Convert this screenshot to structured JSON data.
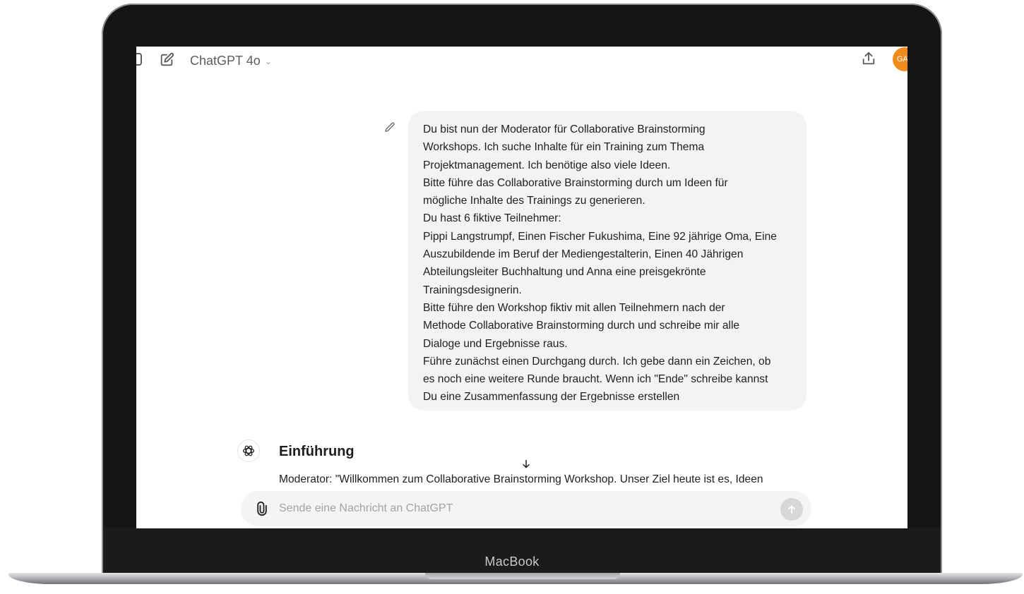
{
  "header": {
    "model_name": "ChatGPT 4o",
    "avatar_initials": "GA",
    "avatar_color": "#f08c1d"
  },
  "conversation": {
    "user_message_lines": [
      "Du bist nun der Moderator für Collaborative Brainstorming",
      "Workshops. Ich suche Inhalte für ein Training zum Thema",
      "Projektmanagement. Ich benötige also viele Ideen.",
      "Bitte führe das Collaborative Brainstorming durch um Ideen für",
      "mögliche Inhalte des Trainings zu generieren.",
      "Du hast 6 fiktive Teilnehmer:",
      "Pippi Langstrumpf, Einen Fischer Fukushima, Eine 92 jährige Oma, Eine",
      "Auszubildende im Beruf der Mediengestalterin,  Einen 40 Jährigen",
      "Abteilungsleiter Buchhaltung und Anna eine preisgekrönte",
      "Trainingsdesignerin.",
      "Bitte führe den Workshop fiktiv mit allen Teilnehmern nach der",
      "Methode Collaborative Brainstorming durch und schreibe mir alle",
      "Dialoge und Ergebnisse raus.",
      "Führe zunächst einen Durchgang durch. Ich gebe dann ein Zeichen, ob",
      "es noch eine weitere Runde braucht. Wenn ich \"Ende\" schreibe kannst",
      "Du eine Zusammenfassung der Ergebnisse erstellen"
    ],
    "assistant_heading": "Einführung",
    "assistant_first_line": "Moderator: \"Willkommen zum Collaborative Brainstorming Workshop. Unser Ziel heute ist es, Ideen"
  },
  "composer": {
    "placeholder": "Sende eine Nachricht an ChatGPT"
  },
  "device": {
    "brand_label": "MacBook"
  }
}
